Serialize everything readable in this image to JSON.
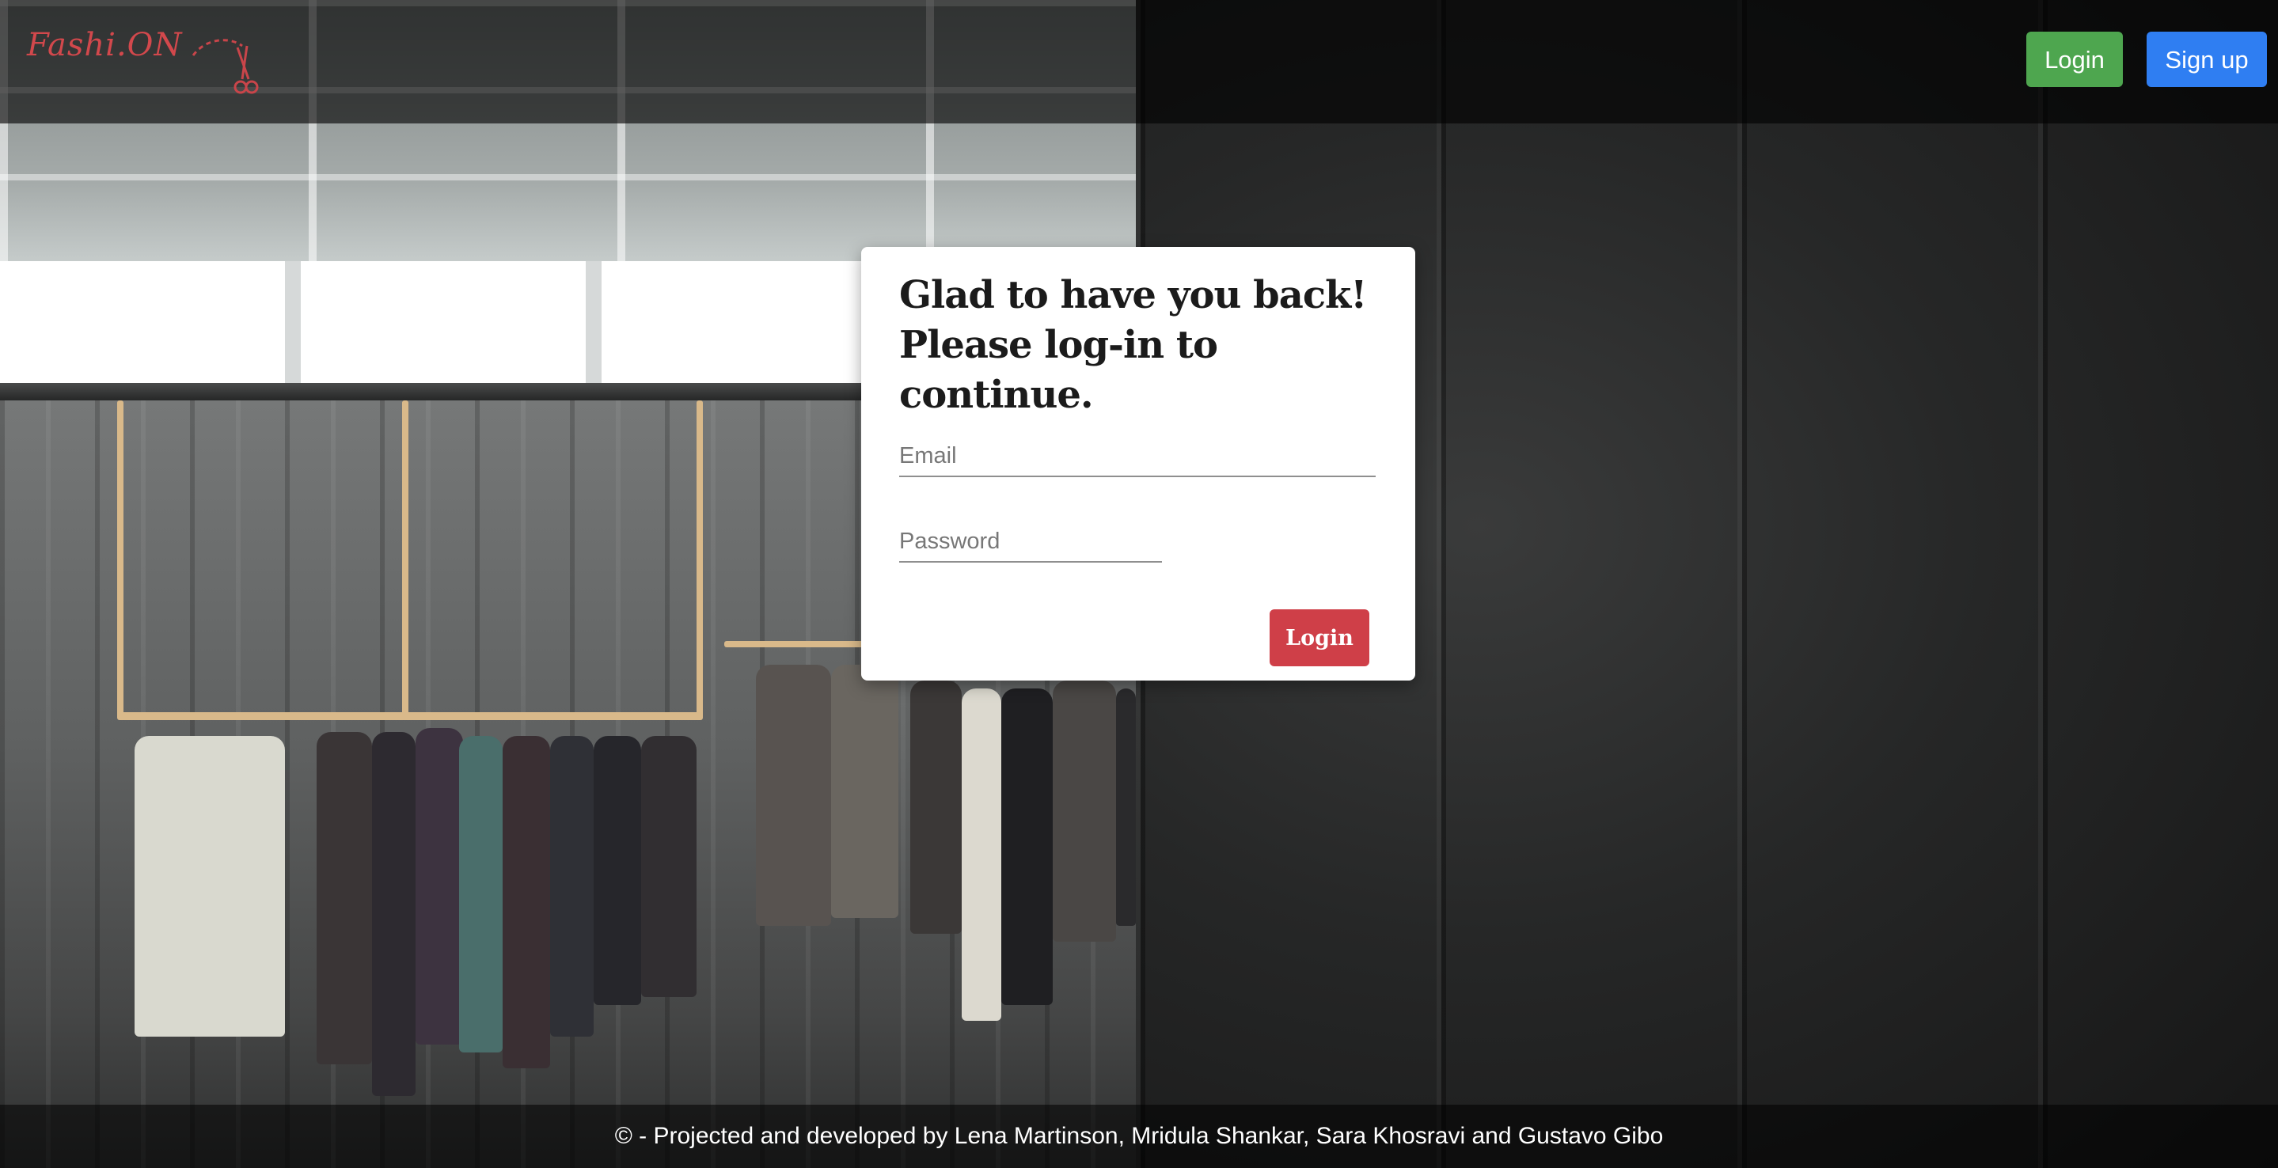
{
  "header": {
    "brand": "Fashi.ON",
    "login_label": "Login",
    "signup_label": "Sign up"
  },
  "login_card": {
    "heading_line1": "Glad to have you back!",
    "heading_line2": "Please log-in to continue.",
    "email_placeholder": "Email",
    "password_placeholder": "Password",
    "submit_label": "Login"
  },
  "footer": {
    "credit": "© - Projected and developed by Lena Martinson, Mridula Shankar, Sara Khosravi and Gustavo Gibo"
  },
  "colors": {
    "brand": "#d2484c",
    "login_button": "#4ea64f",
    "signup_button": "#2f7ef2",
    "submit_button": "#cf3f48"
  },
  "icons": {
    "logo_icon": "scissors-icon"
  }
}
